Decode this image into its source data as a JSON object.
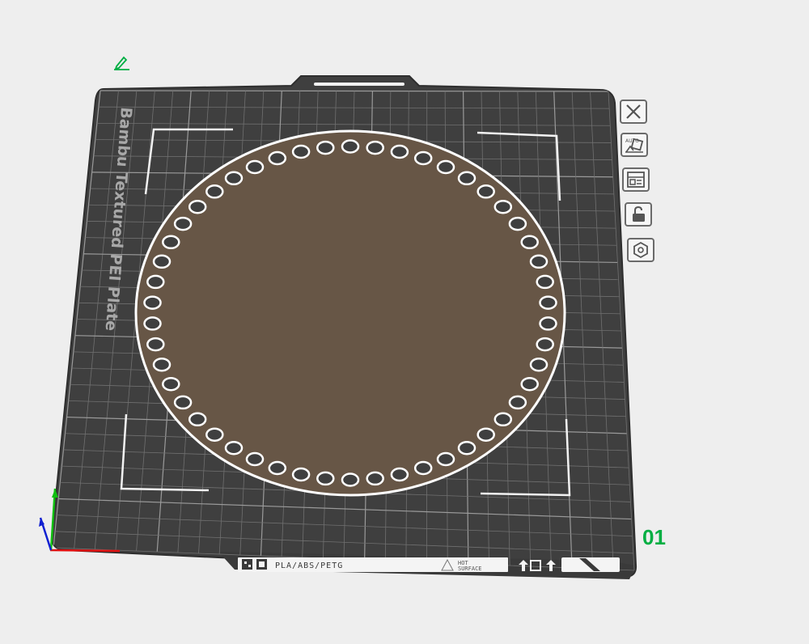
{
  "plate": {
    "brand_text": "Bambu Textured PEI Plate",
    "number": "01",
    "label_filaments": "PLA/ABS/PETG",
    "label_hot_line1": "HOT",
    "label_hot_line2": "SURFACE"
  },
  "toolbar": {
    "buttons": [
      {
        "name": "close-plate",
        "icon": "close-icon"
      },
      {
        "name": "auto-orient",
        "icon": "auto-orient-icon",
        "text": "AUTO"
      },
      {
        "name": "arrange",
        "icon": "arrange-icon"
      },
      {
        "name": "lock",
        "icon": "unlock-icon"
      },
      {
        "name": "plate-settings",
        "icon": "hexagon-settings-icon"
      }
    ]
  },
  "colors": {
    "background": "#eeeeee",
    "plate": "#3f3f3f",
    "grid": "#8a8a8a",
    "object": "#675646",
    "accent": "#00ae42",
    "axis_x": "#e01010",
    "axis_y": "#10c010",
    "axis_z": "#1020d0"
  },
  "object": {
    "hole_count": 50
  }
}
